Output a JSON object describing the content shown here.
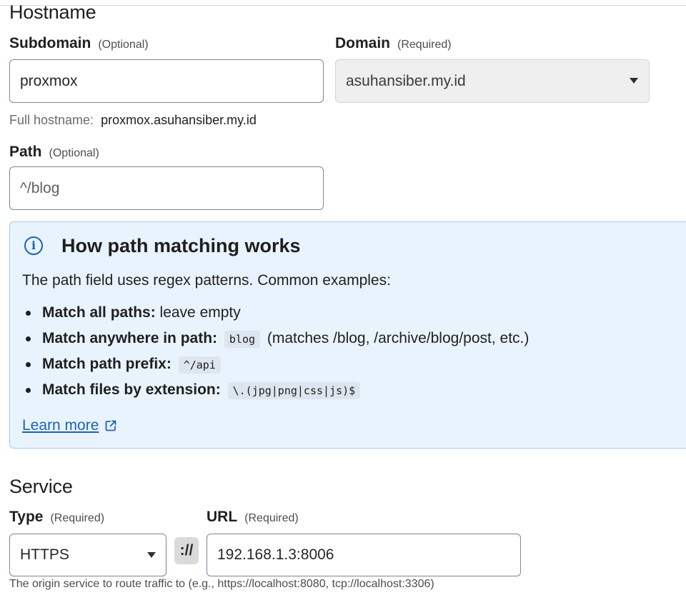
{
  "hostname": {
    "section_title": "Hostname",
    "subdomain": {
      "label": "Subdomain",
      "hint": "(Optional)",
      "value": "proxmox"
    },
    "domain": {
      "label": "Domain",
      "hint": "(Required)",
      "value": "asuhansiber.my.id"
    },
    "full_hostname": {
      "label": "Full hostname:",
      "value": "proxmox.asuhansiber.my.id"
    },
    "path": {
      "label": "Path",
      "hint": "(Optional)",
      "placeholder": "^/blog"
    }
  },
  "info_box": {
    "icon": "info-icon",
    "title": "How path matching works",
    "intro": "The path field uses regex patterns. Common examples:",
    "items": [
      {
        "bold": "Match all paths:",
        "text": " leave empty",
        "code": "",
        "after": ""
      },
      {
        "bold": "Match anywhere in path:",
        "text": "",
        "code": "blog",
        "after": "(matches /blog, /archive/blog/post, etc.)"
      },
      {
        "bold": "Match path prefix:",
        "text": "",
        "code": "^/api",
        "after": ""
      },
      {
        "bold": "Match files by extension:",
        "text": "",
        "code": "\\.(jpg|png|css|js)$",
        "after": ""
      }
    ],
    "learn_more": "Learn more",
    "learn_more_icon": "external-link-icon"
  },
  "service": {
    "section_title": "Service",
    "type": {
      "label": "Type",
      "hint": "(Required)",
      "value": "HTTPS"
    },
    "separator": "://",
    "url": {
      "label": "URL",
      "hint": "(Required)",
      "value": "192.168.1.3:8006"
    },
    "help": "The origin service to route traffic to (e.g., https://localhost:8080, tcp://localhost:3306)"
  },
  "colors": {
    "link": "#1b63b5",
    "info_bg": "#e9f3fd",
    "info_border": "#a9c9ec"
  }
}
